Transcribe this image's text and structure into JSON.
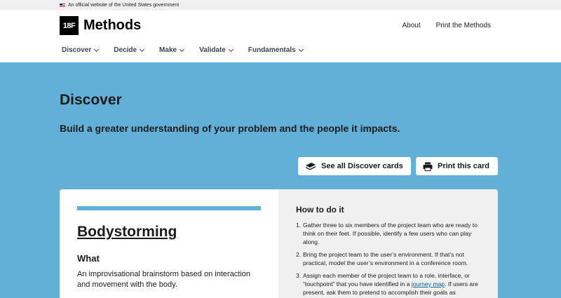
{
  "gov_banner": {
    "text": "An official website of the United States government"
  },
  "header": {
    "logo_mark": "18F",
    "logo_text": "Methods",
    "links": [
      "About",
      "Print the Methods"
    ],
    "nav": [
      "Discover",
      "Decide",
      "Make",
      "Validate",
      "Fundamentals"
    ]
  },
  "hero": {
    "title": "Discover",
    "subtitle": "Build a greater understanding of your problem and the people it impacts."
  },
  "buttons": {
    "see_all": "See all Discover cards",
    "print": "Print this card"
  },
  "card": {
    "title": "Bodystorming",
    "what_heading": "What",
    "what_text": "An improvisational brainstorm based on interaction and movement with the body.",
    "how_heading": "How to do it",
    "steps": [
      {
        "num": "1.",
        "text": "Gather three to six members of the project team who are ready to think on their feet. If possible, identify a few users who can play along."
      },
      {
        "num": "2.",
        "text": "Bring the project team to the user’s environment. If that’s not practical, model the user’s environment in a conference room."
      },
      {
        "num": "3.",
        "text_before": "Assign each member of the project team to a role, interface, or “touchpoint” that you have identified in a ",
        "link": "journey map",
        "text_after": ". If users are present, ask them to pretend to accomplish their goals as"
      }
    ]
  },
  "colors": {
    "hero_bg": "#62b0d8",
    "card_right_bg": "#f0f0f0",
    "link": "#005ea2"
  }
}
